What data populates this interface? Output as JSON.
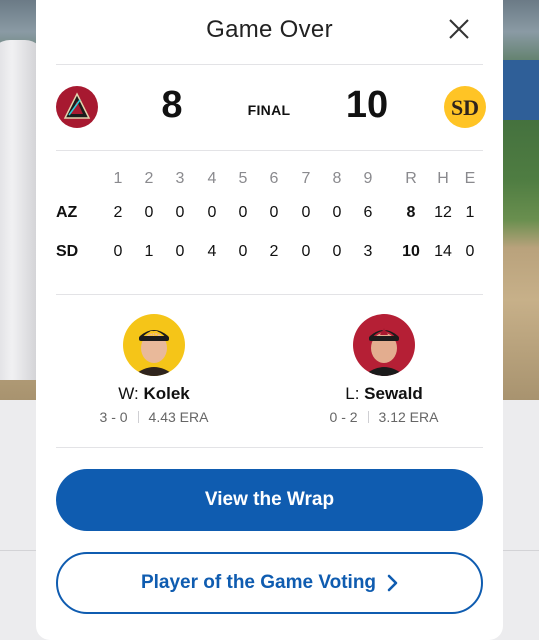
{
  "modal": {
    "title": "Game Over"
  },
  "scoreboard": {
    "away": {
      "abbr": "AZ",
      "score": "8",
      "logo": "arizona-diamondbacks-logo",
      "color": "#a71930"
    },
    "home": {
      "abbr": "SD",
      "score": "10",
      "logo": "san-diego-padres-logo",
      "color": "#ffc425"
    },
    "status": "FINAL"
  },
  "linescore": {
    "innings": [
      "1",
      "2",
      "3",
      "4",
      "5",
      "6",
      "7",
      "8",
      "9"
    ],
    "totals_headers": [
      "R",
      "H",
      "E"
    ],
    "rows": [
      {
        "team": "AZ",
        "innings": [
          "2",
          "0",
          "0",
          "0",
          "0",
          "0",
          "0",
          "0",
          "6"
        ],
        "R": "8",
        "H": "12",
        "E": "1"
      },
      {
        "team": "SD",
        "innings": [
          "0",
          "1",
          "0",
          "4",
          "0",
          "2",
          "0",
          "0",
          "3"
        ],
        "R": "10",
        "H": "14",
        "E": "0"
      }
    ]
  },
  "pitchers": {
    "win": {
      "decision": "W:",
      "name": "Kolek",
      "record": "3 - 0",
      "era": "4.43 ERA"
    },
    "loss": {
      "decision": "L:",
      "name": "Sewald",
      "record": "0 - 2",
      "era": "3.12 ERA"
    }
  },
  "buttons": {
    "wrap": "View the Wrap",
    "vote": "Player of the Game Voting"
  },
  "colors": {
    "primary": "#0f5cb0",
    "az_red": "#a71930",
    "sd_gold": "#ffc425"
  }
}
